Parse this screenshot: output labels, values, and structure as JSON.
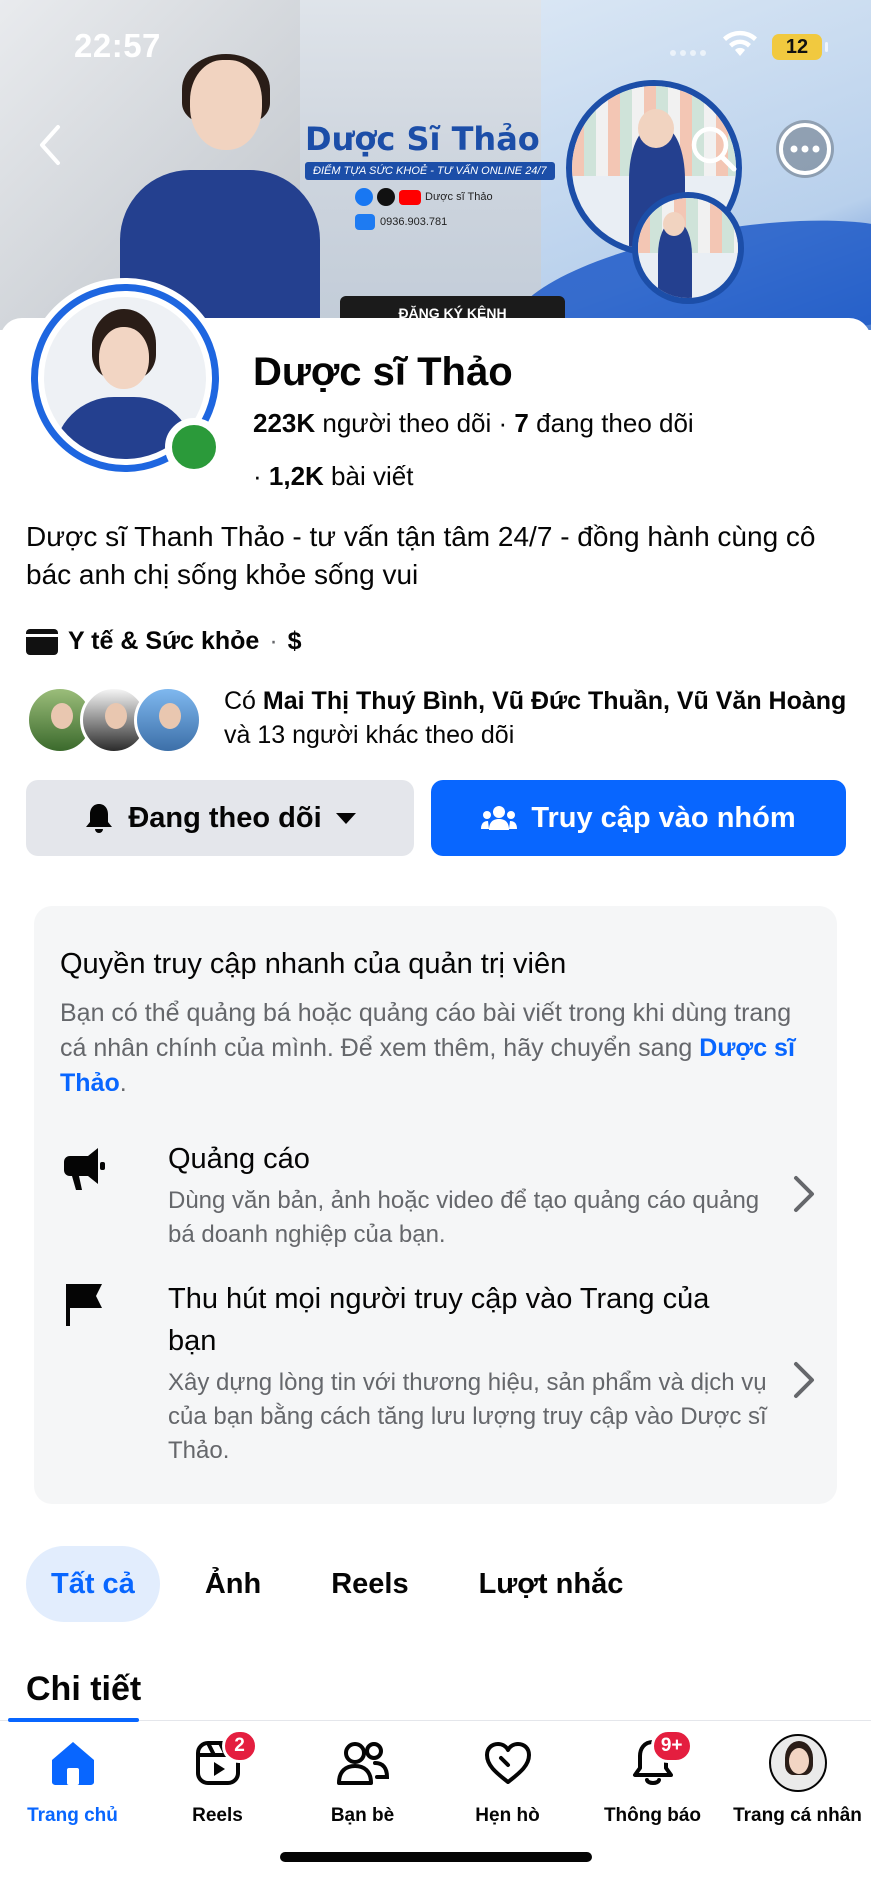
{
  "status_bar": {
    "time": "22:57",
    "battery": "12"
  },
  "cover": {
    "brand_name": "Dược Sĩ Thảo",
    "tagline": "ĐIỂM TỰA SỨC KHOẺ - TƯ VẤN ONLINE 24/7",
    "social_handle": "Dược sĩ Thảo",
    "zalo_phone": "0936.903.781",
    "subscribe_label": "ĐĂNG KÝ KÊNH"
  },
  "profile": {
    "name": "Dược sĩ Thảo",
    "followers_count": "223K",
    "followers_label": "người theo dõi",
    "following_count": "7",
    "following_label": "đang theo dõi",
    "posts_count": "1,2K",
    "posts_label": "bài viết",
    "bio": "Dược sĩ Thanh Thảo - tư vấn tận tâm 24/7 - đồng hành cùng cô bác anh chị sống khỏe sống vui",
    "category": "Y tế & Sức khỏe",
    "price_range": "$"
  },
  "mutual_followers": {
    "prefix": "Có",
    "names": "Mai Thị Thuý Bình, Vũ Đức Thuần, Vũ Văn Hoàng",
    "suffix": "và 13 người khác theo dõi"
  },
  "actions": {
    "following_label": "Đang theo dõi",
    "group_label": "Truy cập vào nhóm"
  },
  "admin_card": {
    "title": "Quyền truy cập nhanh của quản trị viên",
    "desc_prefix": "Bạn có thể quảng bá hoặc quảng cáo bài viết trong khi dùng trang cá nhân chính của mình. Để xem thêm, hãy chuyển sang",
    "desc_link": "Dược sĩ Thảo",
    "items": [
      {
        "title": "Quảng cáo",
        "subtitle": "Dùng văn bản, ảnh hoặc video để tạo quảng cáo quảng bá doanh nghiệp của bạn.",
        "icon": "megaphone-icon"
      },
      {
        "title": "Thu hút mọi người truy cập vào Trang của bạn",
        "subtitle": "Xây dựng lòng tin với thương hiệu, sản phẩm và dịch vụ của bạn bằng cách tăng lưu lượng truy cập vào Dược sĩ Thảo.",
        "icon": "flag-icon"
      }
    ]
  },
  "tabs": [
    {
      "label": "Tất cả",
      "active": true
    },
    {
      "label": "Ảnh"
    },
    {
      "label": "Reels"
    },
    {
      "label": "Lượt nhắc"
    }
  ],
  "section_title": "Chi tiết",
  "bottom_nav": [
    {
      "label": "Trang chủ",
      "icon": "home-icon",
      "active": true
    },
    {
      "label": "Reels",
      "icon": "reels-icon",
      "badge": "2"
    },
    {
      "label": "Bạn bè",
      "icon": "friends-icon"
    },
    {
      "label": "Hẹn hò",
      "icon": "heart-icon"
    },
    {
      "label": "Thông báo",
      "icon": "bell-icon",
      "badge": "9+"
    },
    {
      "label": "Trang cá nhân",
      "icon": "profile-avatar"
    }
  ],
  "colors": {
    "accent": "#0866ff",
    "badge": "#e41e3f",
    "online": "#2b9a3a"
  }
}
